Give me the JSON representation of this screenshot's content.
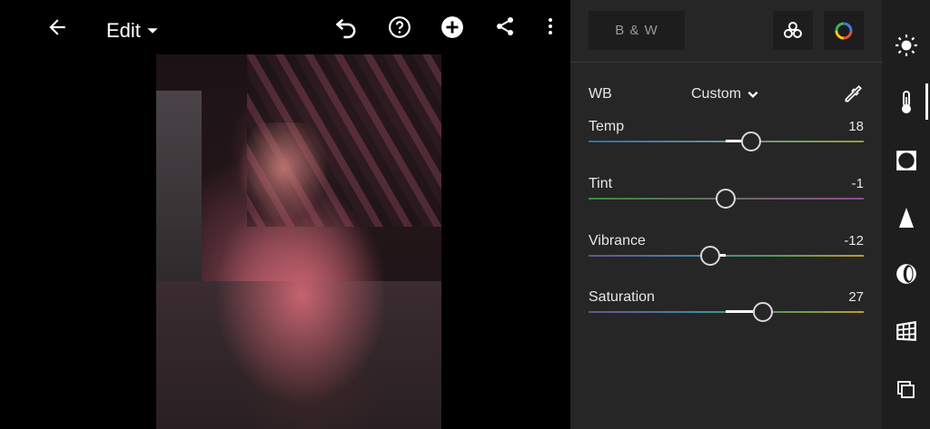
{
  "topbar": {
    "back_icon": "arrow-left-icon",
    "edit_label": "Edit",
    "icons": [
      "undo-icon",
      "help-icon",
      "add-icon",
      "share-icon",
      "more-vert-icon"
    ]
  },
  "panel": {
    "bw_label": "B & W",
    "wb": {
      "label": "WB",
      "value": "Custom"
    },
    "sliders": [
      {
        "label": "Temp",
        "value": "18",
        "position": 0.59
      },
      {
        "label": "Tint",
        "value": "-1",
        "position": 0.495
      },
      {
        "label": "Vibrance",
        "value": "-12",
        "position": 0.44
      },
      {
        "label": "Saturation",
        "value": "27",
        "position": 0.635
      }
    ],
    "track_colors": {
      "temp": [
        "#2a6fa6",
        "#8aa33b"
      ],
      "tint": [
        "#3c8c3a",
        "#8c4c8c"
      ],
      "vibrance": [
        "#6a4f8f",
        "#4a9c5a"
      ],
      "saturation": [
        "#6a4f8f",
        "#c09a2a"
      ]
    }
  },
  "rail": {
    "icons": [
      "light-icon",
      "color-thermometer-icon",
      "effects-vignette-icon",
      "detail-icon",
      "optics-icon",
      "geometry-icon",
      "versions-icon"
    ],
    "selected": "color-thermometer-icon"
  },
  "colors": {
    "panel_bg": "#262626",
    "rail_bg": "#1e1e1e",
    "text": "#e6e6e6"
  }
}
